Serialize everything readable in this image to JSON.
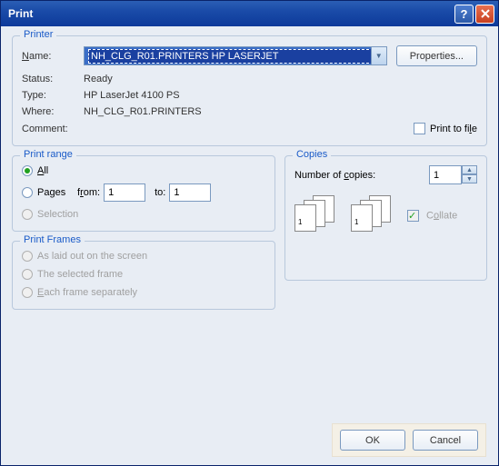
{
  "title": "Print",
  "printer": {
    "legend": "Printer",
    "name_label": "Name:",
    "name_value": "NH_CLG_R01.PRINTERS HP LASERJET",
    "properties_btn": "Properties...",
    "status_label": "Status:",
    "status_value": "Ready",
    "type_label": "Type:",
    "type_value": "HP LaserJet 4100 PS",
    "where_label": "Where:",
    "where_value": "NH_CLG_R01.PRINTERS",
    "comment_label": "Comment:",
    "comment_value": "",
    "print_to_file": "Print to file"
  },
  "range": {
    "legend": "Print range",
    "all": "All",
    "pages": "Pages",
    "from_label": "from:",
    "from_value": "1",
    "to_label": "to:",
    "to_value": "1",
    "selection": "Selection"
  },
  "copies": {
    "legend": "Copies",
    "num_label": "Number of copies:",
    "num_value": "1",
    "collate": "Collate"
  },
  "frames": {
    "legend": "Print Frames",
    "opt1": "As laid out on the screen",
    "opt2": "The selected frame",
    "opt3": "Each frame separately"
  },
  "buttons": {
    "ok": "OK",
    "cancel": "Cancel"
  }
}
